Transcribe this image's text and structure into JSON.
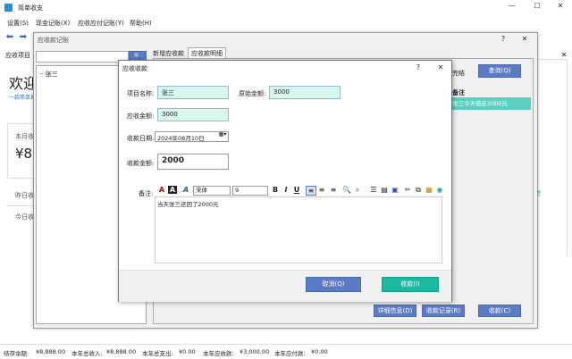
{
  "app": {
    "title": "简单收支"
  },
  "menu": [
    "设置(S)",
    "现金记账(X)",
    "应收应付记账(Y)",
    "帮助(H)"
  ],
  "main": {
    "tab_label": "应收项目",
    "welcome": "欢迎",
    "tagline": "一款简单易",
    "month_label": "本月收",
    "amount_partial": "¥8,8",
    "yesterday_label": "昨日收",
    "today_label": "今日收"
  },
  "records_window": {
    "title": "应收款记账",
    "tree_item": "张三",
    "tabs": [
      "新增应收款",
      "应收款明细"
    ],
    "complete_label": "完结",
    "query_button": "查询(Q)",
    "remark_header": "备注",
    "remark_cell": "张三今天借走3000元",
    "detail_button": "详细信息(D)",
    "collect_record_button": "收款记录(R)",
    "collect_button": "收款(C)"
  },
  "dialog": {
    "title": "应收收款",
    "project_label": "项目名称:",
    "project_value": "张三",
    "original_label": "原始金额:",
    "original_value": "3000",
    "receivable_label": "应收金额:",
    "receivable_value": "3000",
    "date_label": "收款日期:",
    "date_value": "2024年08月10日",
    "amount_label": "收款金额:",
    "amount_value": "2000",
    "remark_label": "备注:",
    "font_name": "宋体",
    "font_size": "9",
    "remark_text": "当天张三还回了2000元",
    "cancel_button": "取消(Q)",
    "confirm_button": "收款(I)"
  },
  "status": {
    "balance_label": "结存余额:",
    "balance": "¥8,888.00",
    "income_label": "本年总收入:",
    "income": "¥8,888.00",
    "expense_label": "本年总支出:",
    "expense": "¥0.00",
    "receivable_label": "本年应收款:",
    "receivable": "¥3,000.00",
    "payable_label": "本年应付款:",
    "payable": "¥0.00"
  },
  "colors": {
    "accent": "#5b7bc5",
    "field": "#d7f7ee",
    "confirm": "#1bb9a0",
    "selected_row": "#5ccfc0"
  }
}
